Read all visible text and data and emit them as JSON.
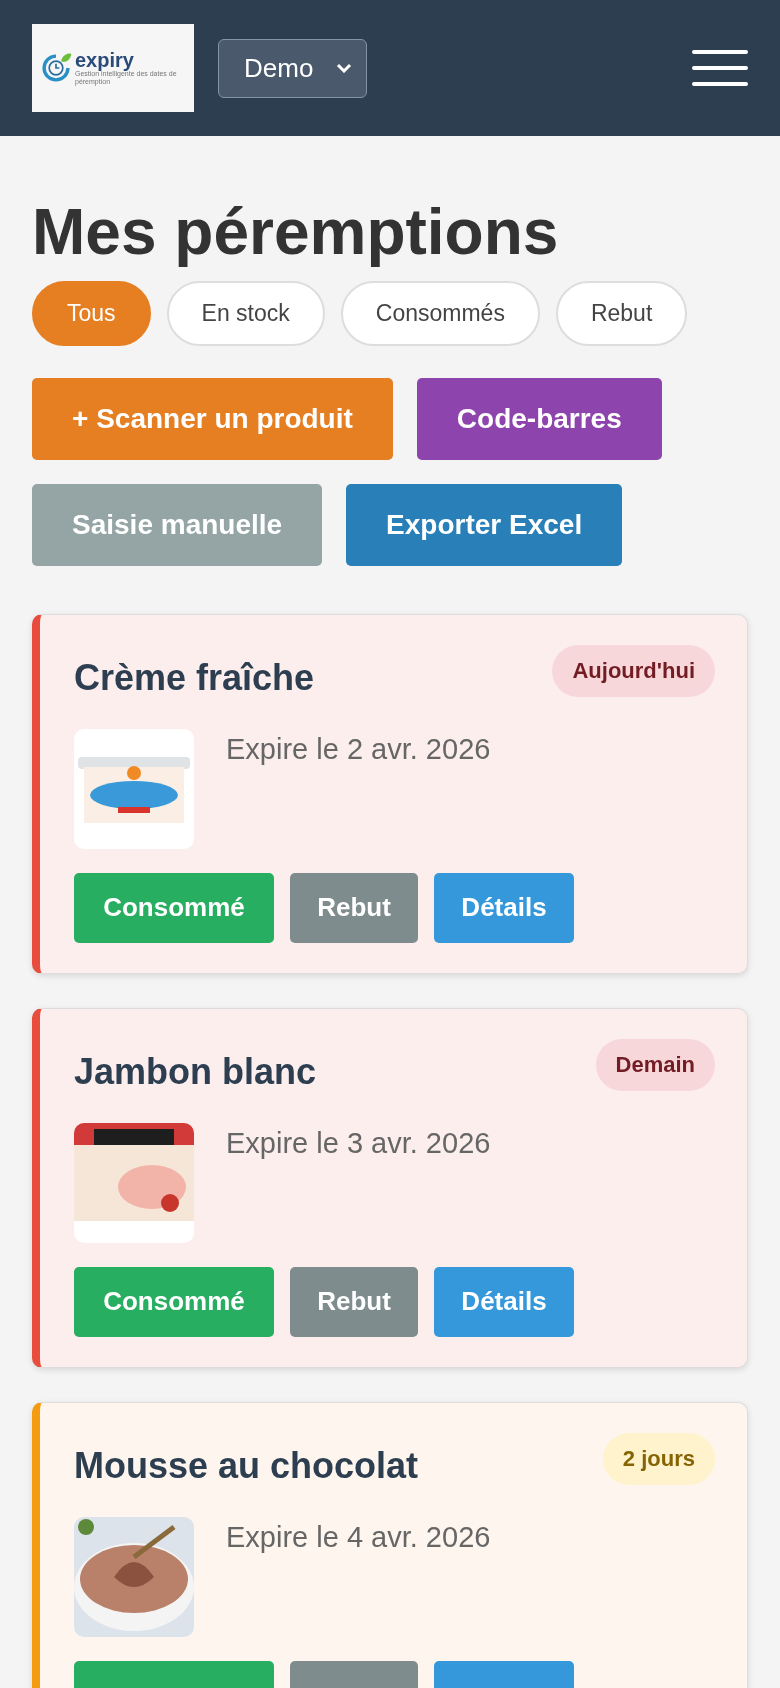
{
  "header": {
    "logo_text": "expiry",
    "logo_tagline": "Gestion intelligente des dates de péremption",
    "site_select": "Demo"
  },
  "title": "Mes péremptions",
  "filters": [
    {
      "label": "Tous",
      "selected": true
    },
    {
      "label": "En stock",
      "selected": false
    },
    {
      "label": "Consommés",
      "selected": false
    },
    {
      "label": "Rebut",
      "selected": false
    }
  ],
  "actions": [
    {
      "label": "+ Scanner un produit",
      "kind": "scan"
    },
    {
      "label": "Code-barres",
      "kind": "barcode"
    },
    {
      "label": "Saisie manuelle",
      "kind": "manual"
    },
    {
      "label": "Exporter Excel",
      "kind": "export"
    }
  ],
  "products": [
    {
      "name": "Crème fraîche",
      "badge": "Aujourd'hui",
      "kind": "critical",
      "expiry": "Expire le 2 avr. 2026",
      "image": {
        "kind": "picture"
      },
      "buttons": [
        {
          "kind": "consume",
          "label": "Consommé"
        },
        {
          "kind": "discard",
          "label": "Rebut"
        },
        {
          "kind": "details",
          "label": "Détails"
        }
      ]
    },
    {
      "name": "Jambon blanc",
      "badge": "Demain",
      "kind": "critical",
      "expiry": "Expire le 3 avr. 2026",
      "image": {
        "kind": "picture"
      },
      "buttons": [
        {
          "kind": "consume",
          "label": "Consommé"
        },
        {
          "kind": "discard",
          "label": "Rebut"
        },
        {
          "kind": "details",
          "label": "Détails"
        }
      ]
    },
    {
      "name": "Mousse au chocolat",
      "badge": "2 jours",
      "kind": "warning",
      "expiry": "Expire le 4 avr. 2026",
      "image": {
        "kind": "picture"
      },
      "buttons": [
        {
          "kind": "consume"
        },
        {
          "kind": "discard"
        },
        {
          "kind": "details"
        }
      ]
    }
  ]
}
